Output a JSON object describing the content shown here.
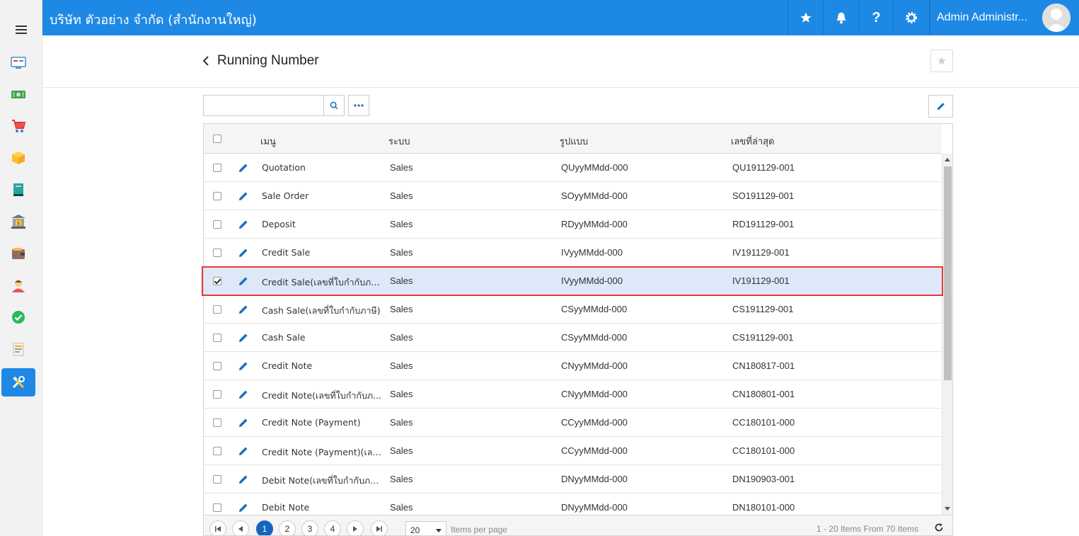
{
  "topbar": {
    "company": "บริษัท ตัวอย่าง จำกัด (สำนักงานใหญ่)",
    "user_name": "Admin Administr...",
    "buttons": [
      "star-icon",
      "bell-icon",
      "help-icon",
      "gear-icon"
    ]
  },
  "sidebar": {
    "items": [
      {
        "icon": "dashboard-icon"
      },
      {
        "icon": "money-icon"
      },
      {
        "icon": "cart-icon"
      },
      {
        "icon": "box-icon"
      },
      {
        "icon": "book-icon"
      },
      {
        "icon": "bank-icon"
      },
      {
        "icon": "wallet-icon"
      },
      {
        "icon": "person-icon"
      },
      {
        "icon": "check-circle-icon"
      },
      {
        "icon": "document-icon"
      },
      {
        "icon": "tools-icon",
        "active": true
      }
    ]
  },
  "page": {
    "title": "Running Number"
  },
  "search": {
    "value": "",
    "placeholder": ""
  },
  "table": {
    "columns": [
      "เมนู",
      "ระบบ",
      "รูปแบบ",
      "เลขที่ล่าสุด"
    ],
    "rows": [
      {
        "menu": "Quotation",
        "system": "Sales",
        "format": "QUyyMMdd-000",
        "latest": "QU191129-001",
        "checked": false
      },
      {
        "menu": "Sale Order",
        "system": "Sales",
        "format": "SOyyMMdd-000",
        "latest": "SO191129-001",
        "checked": false
      },
      {
        "menu": "Deposit",
        "system": "Sales",
        "format": "RDyyMMdd-000",
        "latest": "RD191129-001",
        "checked": false
      },
      {
        "menu": "Credit Sale",
        "system": "Sales",
        "format": "IVyyMMdd-000",
        "latest": "IV191129-001",
        "checked": false
      },
      {
        "menu": "Credit Sale(เลขที่ใบกำกับภา...",
        "system": "Sales",
        "format": "IVyyMMdd-000",
        "latest": "IV191129-001",
        "checked": true
      },
      {
        "menu": "Cash Sale(เลขที่ใบกำกับภาษี)",
        "system": "Sales",
        "format": "CSyyMMdd-000",
        "latest": "CS191129-001",
        "checked": false
      },
      {
        "menu": "Cash Sale",
        "system": "Sales",
        "format": "CSyyMMdd-000",
        "latest": "CS191129-001",
        "checked": false
      },
      {
        "menu": "Credit Note",
        "system": "Sales",
        "format": "CNyyMMdd-000",
        "latest": "CN180817-001",
        "checked": false
      },
      {
        "menu": "Credit Note(เลขที่ใบกำกับภ...",
        "system": "Sales",
        "format": "CNyyMMdd-000",
        "latest": "CN180801-001",
        "checked": false
      },
      {
        "menu": "Credit Note (Payment)",
        "system": "Sales",
        "format": "CCyyMMdd-000",
        "latest": "CC180101-000",
        "checked": false
      },
      {
        "menu": "Credit Note (Payment)(เลข...",
        "system": "Sales",
        "format": "CCyyMMdd-000",
        "latest": "CC180101-000",
        "checked": false
      },
      {
        "menu": "Debit Note(เลขที่ใบกำกับภา...",
        "system": "Sales",
        "format": "DNyyMMdd-000",
        "latest": "DN190903-001",
        "checked": false
      },
      {
        "menu": "Debit Note",
        "system": "Sales",
        "format": "DNyyMMdd-000",
        "latest": "DN180101-000",
        "checked": false
      }
    ]
  },
  "pager": {
    "pages": [
      "1",
      "2",
      "3",
      "4"
    ],
    "current": "1",
    "page_size": "20",
    "per_page_label": "Items per page",
    "info": "1 - 20 Items From 70 Items"
  },
  "colors": {
    "primary": "#1e88e5",
    "selected_row": "#dde8f8",
    "highlight_border": "#e53935",
    "pager_current": "#1565c0"
  }
}
